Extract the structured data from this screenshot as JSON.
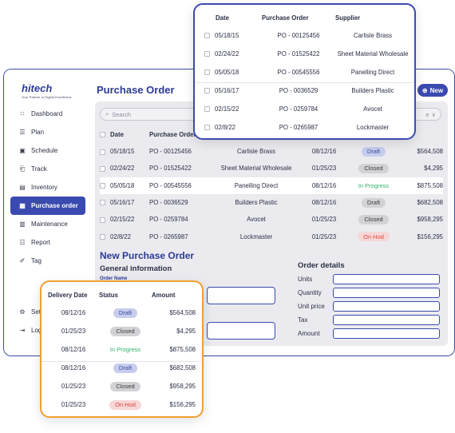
{
  "app": {
    "logo_text": "hitech",
    "logo_tagline": "Your Partner in Digital Excellence"
  },
  "sidebar": {
    "items": [
      {
        "label": "Dashboard",
        "icon": "grid-icon"
      },
      {
        "label": "Plan",
        "icon": "list-icon"
      },
      {
        "label": "Schedule",
        "icon": "calendar-icon"
      },
      {
        "label": "Track",
        "icon": "clipboard-icon"
      },
      {
        "label": "Inventory",
        "icon": "boxes-icon"
      },
      {
        "label": "Purchase order",
        "icon": "cart-icon",
        "active": true
      },
      {
        "label": "Maintenance",
        "icon": "tools-icon"
      },
      {
        "label": "Report",
        "icon": "report-icon"
      },
      {
        "label": "Tag",
        "icon": "tag-icon"
      }
    ],
    "bottom_items": [
      {
        "label": "Set",
        "icon": "gear-icon"
      },
      {
        "label": "Log",
        "icon": "logout-icon"
      }
    ]
  },
  "header": {
    "title": "Purchase Order",
    "new_button": "New"
  },
  "toolbar": {
    "search_placeholder": "Search",
    "filter_label": "e"
  },
  "table": {
    "columns": [
      "Date",
      "Purchase Order",
      "Supplier",
      "Delivery Date",
      "Status",
      "Amount"
    ],
    "visible_header": {
      "date": "Date",
      "po": "Purchase Order",
      "amount": "unt"
    },
    "rows": [
      {
        "date": "05/18/15",
        "po": "PO - 00125456",
        "supplier": "Carlisle Brass",
        "delivery": "08/12/16",
        "status": "Draft",
        "amount": "$564,508"
      },
      {
        "date": "02/24/22",
        "po": "PO - 01525422",
        "supplier": "Sheet Material Wholesale",
        "delivery": "01/25/23",
        "status": "Closed",
        "amount": "$4,295"
      },
      {
        "date": "05/05/18",
        "po": "PO - 00545556",
        "supplier": "Panelling Direct",
        "delivery": "08/12/16",
        "status": "In Progress",
        "amount": "$875,508"
      },
      {
        "date": "05/16/17",
        "po": "PO - 0036529",
        "supplier": "Builders Plastic",
        "delivery": "08/12/16",
        "status": "Draft",
        "amount": "$682,508"
      },
      {
        "date": "02/15/22",
        "po": "PO - 0259784",
        "supplier": "Avocet",
        "delivery": "01/25/23",
        "status": "Closed",
        "amount": "$958,295"
      },
      {
        "date": "02/8/22",
        "po": "PO - 0265987",
        "supplier": "Lockmaster",
        "delivery": "01/25/23",
        "status": "On Hod",
        "amount": "$156,295"
      }
    ]
  },
  "form": {
    "title": "New Purchase Order",
    "general_title": "General information",
    "order_name_label": "Order Name",
    "order_details_title": "Order details",
    "order_fields": [
      "Units",
      "Quantity",
      "Unit price",
      "Tax",
      "Amount"
    ]
  },
  "colors": {
    "brand": "#3b4ab0",
    "accent_orange": "#f0a030",
    "in_progress": "#2fb36b",
    "on_hold": "#e0463d"
  }
}
